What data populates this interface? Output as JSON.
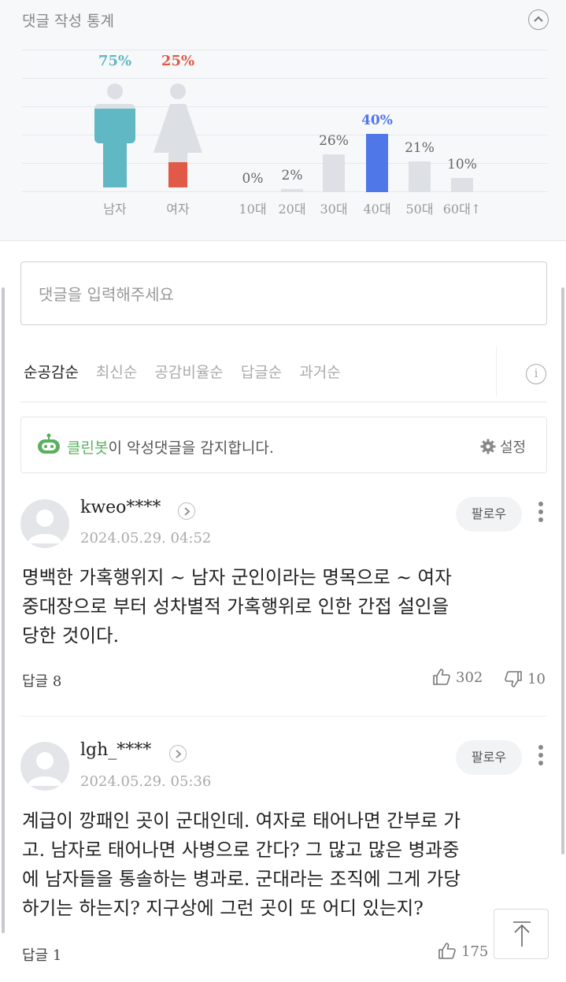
{
  "stats": {
    "title": "댓글 작성 통계",
    "gender": [
      {
        "label": "남자",
        "percent": "75%",
        "value": 75,
        "color": "#5fb8c3"
      },
      {
        "label": "여자",
        "percent": "25%",
        "value": 25,
        "color": "#e05a47"
      }
    ],
    "age": [
      {
        "label": "10대",
        "percent": "0%",
        "value": 0
      },
      {
        "label": "20대",
        "percent": "2%",
        "value": 2
      },
      {
        "label": "30대",
        "percent": "26%",
        "value": 26
      },
      {
        "label": "40대",
        "percent": "40%",
        "value": 40,
        "highlight": true
      },
      {
        "label": "50대",
        "percent": "21%",
        "value": 21
      },
      {
        "label": "60대↑",
        "percent": "10%",
        "value": 10
      }
    ]
  },
  "input": {
    "placeholder": "댓글을 입력해주세요"
  },
  "sort_tabs": [
    "순공감순",
    "최신순",
    "공감비율순",
    "답글순",
    "과거순"
  ],
  "cleanbot": {
    "brand": "클린봇",
    "text": "이 악성댓글을 감지합니다.",
    "settings_label": "설정"
  },
  "comments": [
    {
      "username": "kweo****",
      "timestamp": "2024.05.29. 04:52",
      "follow_label": "팔로우",
      "lines": [
        "명백한 가혹행위지 ~ 남자 군인이라는 명목으로 ~ 여자",
        "중대장으로 부터 성차별적 가혹행위로 인한 간접 설인을",
        "당한 것이다."
      ],
      "reply_label": "답글 8",
      "likes": "302",
      "dislikes": "10"
    },
    {
      "username": "lgh_****",
      "timestamp": "2024.05.29. 05:36",
      "follow_label": "팔로우",
      "lines": [
        "계급이 깡패인 곳이 군대인데. 여자로 태어나면 간부로 가",
        "고. 남자로 태어나면 사병으로 간다? 그 많고 많은 병과중",
        "에 남자들을 통솔하는 병과로. 군대라는 조직에 그게 가당",
        "하기는 하는지? 지구상에 그런 곳이 또 어디 있는지?"
      ],
      "reply_label": "답글 1",
      "likes": "175",
      "dislikes": ""
    }
  ]
}
